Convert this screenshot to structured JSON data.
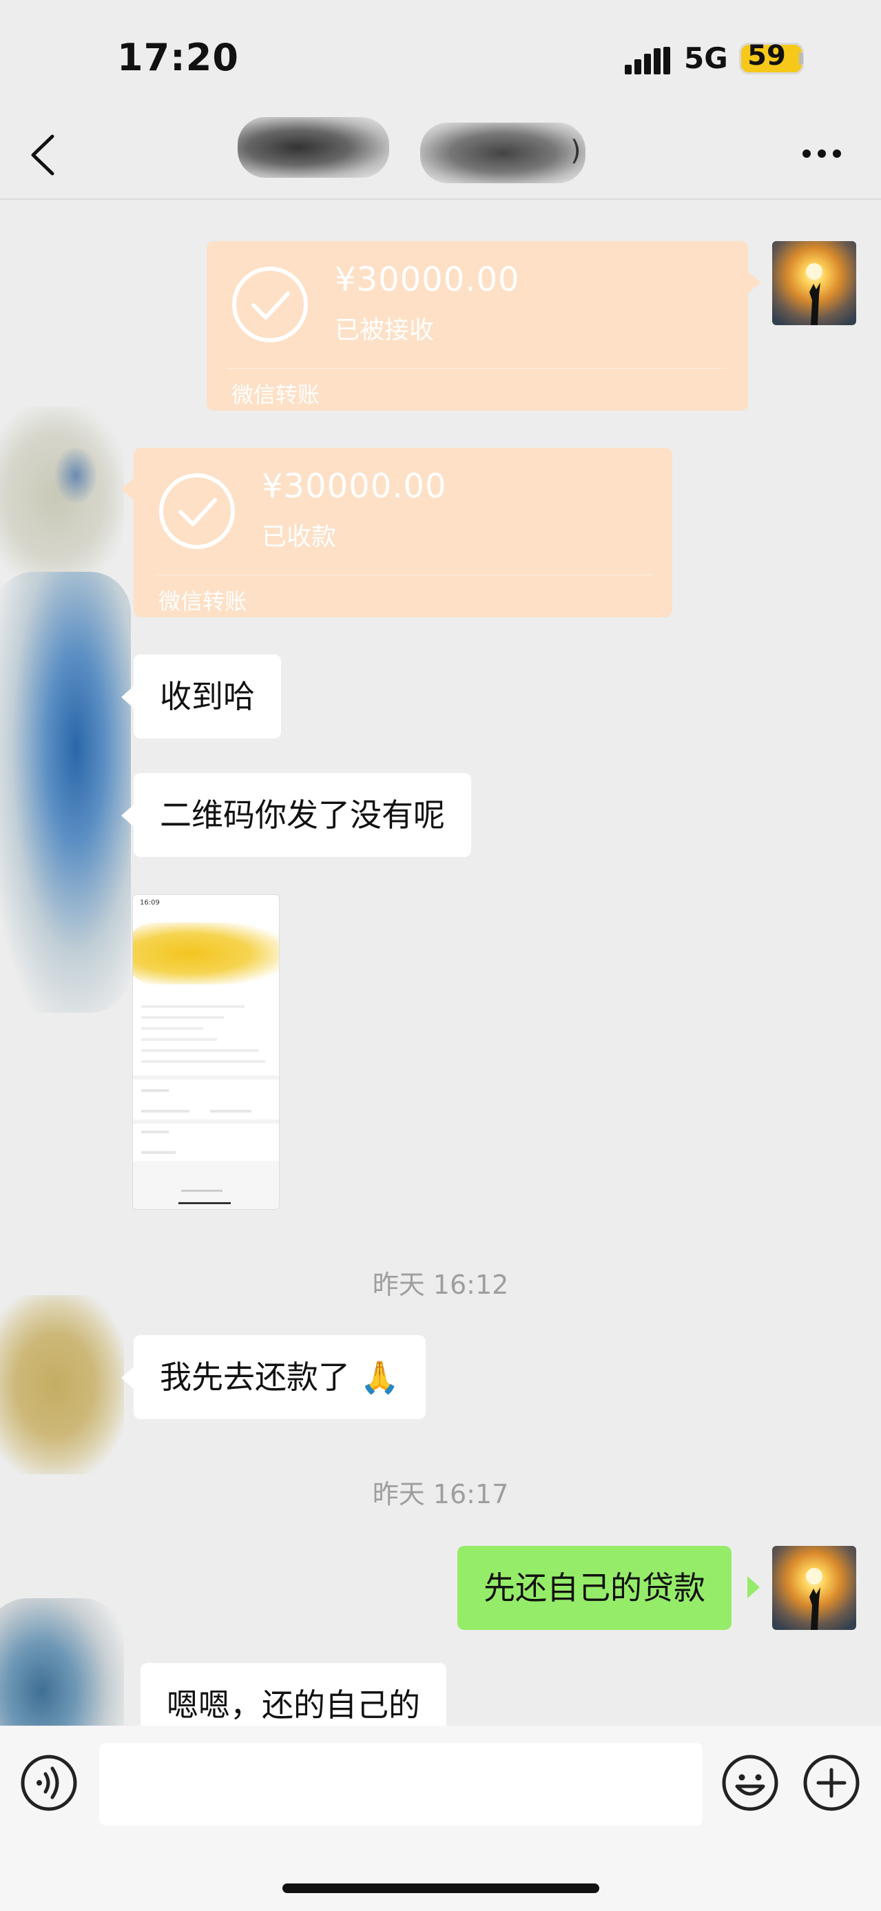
{
  "status_bar": {
    "time": "17:20",
    "network": "5G",
    "battery": "59"
  },
  "header": {
    "title_suffix": ")",
    "back_icon": "chevron-left-icon",
    "more_icon": "more-dots-icon"
  },
  "messages": {
    "transfer_sent": {
      "amount": "¥30000.00",
      "status": "已被接收",
      "label": "微信转账"
    },
    "transfer_received": {
      "amount": "¥30000.00",
      "status": "已收款",
      "label": "微信转账"
    },
    "msg1": "收到哈",
    "msg2": "二维码你发了没有呢",
    "screenshot_thumb": {
      "time": "16:09"
    },
    "timestamp1": "昨天 16:12",
    "msg3": "我先去还款了",
    "msg3_emoji": "🙏",
    "timestamp2": "昨天 16:17",
    "msg_me": "先还自己的贷款",
    "msg4": "嗯嗯，还的自己的"
  },
  "input_bar": {
    "voice_icon": "voice-icon",
    "emoji_icon": "emoji-icon",
    "plus_icon": "plus-icon"
  },
  "colors": {
    "background": "#ededed",
    "transfer_card": "#fde0c6",
    "my_bubble": "#95ec69",
    "battery": "#f5c81a"
  }
}
